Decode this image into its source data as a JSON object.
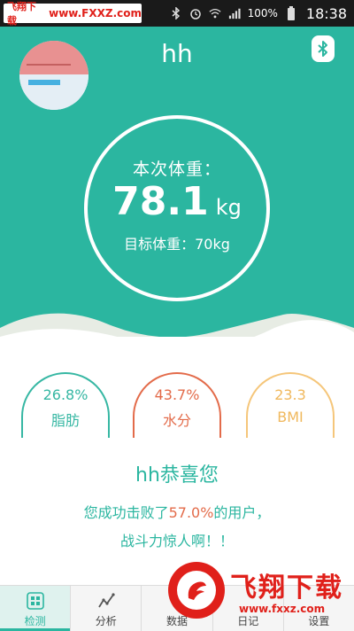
{
  "status_bar": {
    "watermark_left": "飞翔下载",
    "watermark_url": "www.FXXZ.com",
    "battery": "100%",
    "time": "18:38",
    "icons": [
      "bluetooth-icon",
      "alarm-icon",
      "wifi-icon",
      "signal-icon",
      "battery-icon"
    ]
  },
  "header": {
    "user_name": "hh",
    "bluetooth_icon": "bluetooth-icon",
    "weight_title": "本次体重：",
    "weight_value": "78.1",
    "weight_unit": "kg",
    "target": "目标体重：70kg",
    "bg_color": "#2bb6a0"
  },
  "metrics": [
    {
      "value": "26.8%",
      "label": "脂肪",
      "color": "#36b7a3"
    },
    {
      "value": "43.7%",
      "label": "水分",
      "color": "#e36b4a"
    },
    {
      "value": "23.3",
      "label": "BMI",
      "color": "#f0b85d"
    }
  ],
  "congrats": {
    "title": "hh恭喜您",
    "line1_prefix": "您成功击败了",
    "line1_pct": "57.0%",
    "line1_suffix": "的用户，",
    "line2": "战斗力惊人啊！！"
  },
  "nav": [
    {
      "label": "检测",
      "icon": "grid-icon",
      "active": true
    },
    {
      "label": "分析",
      "icon": "chart-line-icon",
      "active": false
    },
    {
      "label": "数据",
      "icon": "data-icon",
      "active": false
    },
    {
      "label": "日记",
      "icon": "diary-icon",
      "active": false
    },
    {
      "label": "设置",
      "icon": "settings-icon",
      "active": false
    }
  ],
  "watermark": {
    "title": "飞翔下载",
    "url": "www.fxxz.com"
  }
}
